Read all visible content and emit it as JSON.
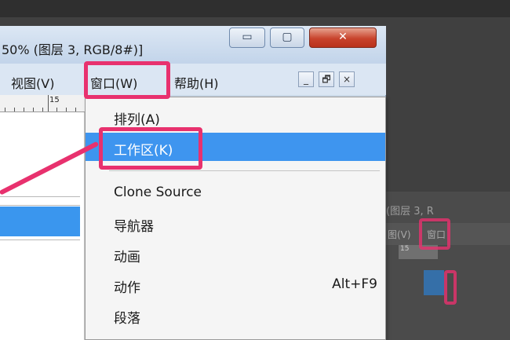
{
  "window": {
    "title": "50% (图层 3, RGB/8#)]",
    "buttons": {
      "minimize": "▭",
      "maximize": "▢",
      "close": "✕"
    }
  },
  "menubar": {
    "items": [
      {
        "label": "视图(V)"
      },
      {
        "label": "窗口(W)"
      },
      {
        "label": "帮助(H)"
      }
    ],
    "mdi": {
      "minimize": "_",
      "restore": "🗗",
      "close": "×"
    }
  },
  "ruler": {
    "label": "15"
  },
  "dropdown": {
    "items": [
      {
        "label": "排列(A)",
        "shortcut": ""
      },
      {
        "label": "工作区(K)",
        "shortcut": ""
      },
      {
        "label": "Clone Source",
        "shortcut": ""
      },
      {
        "label": "导航器",
        "shortcut": ""
      },
      {
        "label": "动画",
        "shortcut": ""
      },
      {
        "label": "动作",
        "shortcut": "Alt+F9"
      },
      {
        "label": "段落",
        "shortcut": ""
      }
    ]
  },
  "background_thumb": {
    "title": "(图层 3, R",
    "menu": [
      "图(V)",
      "窗口"
    ],
    "ruler": "15"
  },
  "colors": {
    "highlight": "#3e95ef",
    "annotation": "#e8316e"
  }
}
